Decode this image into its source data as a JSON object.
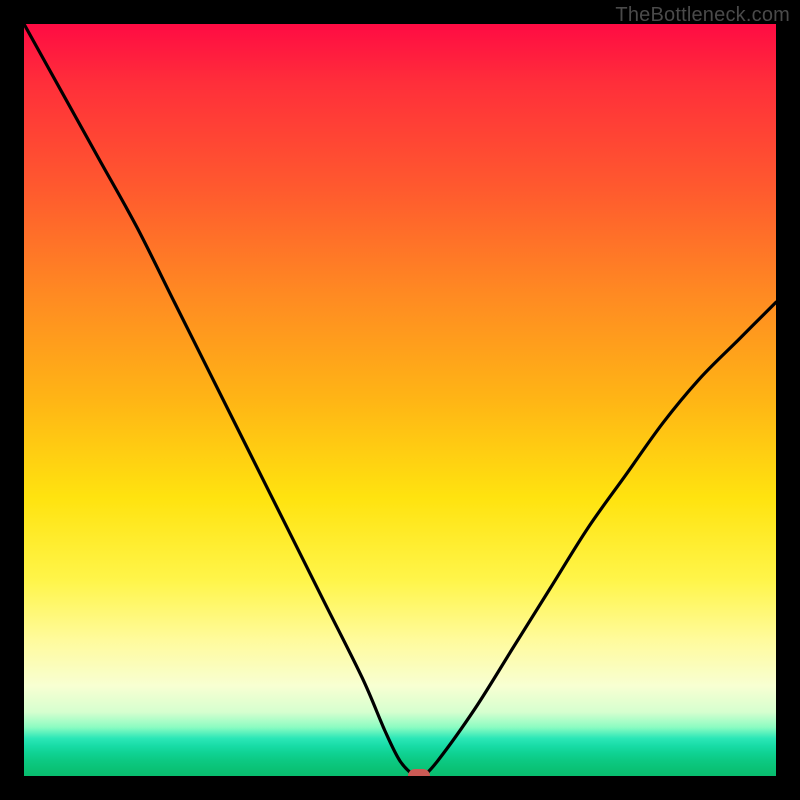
{
  "watermark": "TheBottleneck.com",
  "chart_data": {
    "type": "line",
    "title": "",
    "xlabel": "",
    "ylabel": "",
    "xlim": [
      0,
      100
    ],
    "ylim": [
      0,
      100
    ],
    "grid": false,
    "legend": false,
    "series": [
      {
        "name": "bottleneck-curve",
        "x": [
          0,
          5,
          10,
          15,
          20,
          25,
          30,
          35,
          40,
          45,
          48,
          50,
          52,
          53,
          55,
          60,
          65,
          70,
          75,
          80,
          85,
          90,
          95,
          100
        ],
        "y": [
          100,
          91,
          82,
          73,
          63,
          53,
          43,
          33,
          23,
          13,
          6,
          2,
          0,
          0,
          2,
          9,
          17,
          25,
          33,
          40,
          47,
          53,
          58,
          63
        ]
      }
    ],
    "marker": {
      "x": 52.5,
      "y": 0
    },
    "background_gradient": {
      "top_color": "#ff0b43",
      "mid_yellow": "#ffe30f",
      "bottom_color": "#08bd6f"
    }
  }
}
